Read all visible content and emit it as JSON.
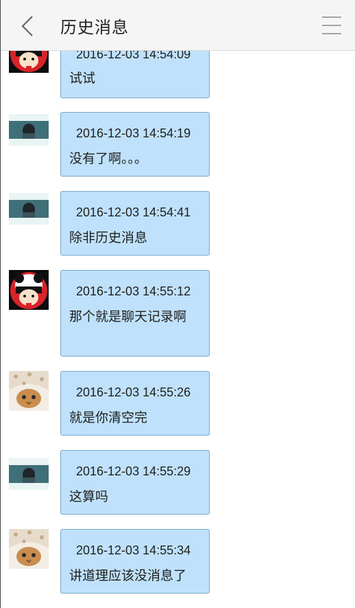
{
  "header": {
    "title": "历史消息"
  },
  "messages": [
    {
      "time": "2016-12-03 14:54:09",
      "text": "试试",
      "avatar": "panda-girl"
    },
    {
      "time": "2016-12-03 14:54:19",
      "text": "没有了啊。。。",
      "avatar": "dark-photo"
    },
    {
      "time": "2016-12-03 14:54:41",
      "text": "除非历史消息",
      "avatar": "dark-photo"
    },
    {
      "time": "2016-12-03 14:55:12",
      "text": "那个就是聊天记录啊",
      "avatar": "panda-girl"
    },
    {
      "time": "2016-12-03 14:55:26",
      "text": "就是你清空完",
      "avatar": "kitten"
    },
    {
      "time": "2016-12-03 14:55:29",
      "text": "这算吗",
      "avatar": "dark-photo"
    },
    {
      "time": "2016-12-03 14:55:34",
      "text": "讲道理应该没消息了",
      "avatar": "kitten"
    }
  ]
}
